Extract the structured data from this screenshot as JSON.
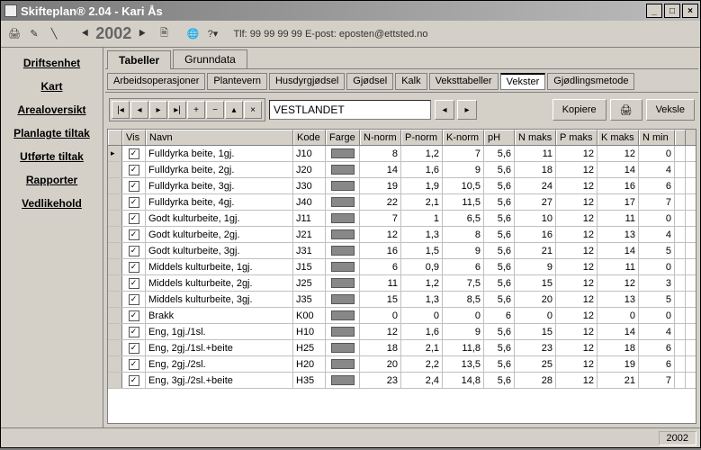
{
  "window": {
    "title": "Skifteplan® 2.04 - Kari Ås"
  },
  "toolbar": {
    "year": "2002",
    "info": "Tlf: 99 99 99 99  E-post: eposten@ettsted.no"
  },
  "sidebar": {
    "items": [
      {
        "label": "Driftsenhet"
      },
      {
        "label": "Kart"
      },
      {
        "label": "Arealoversikt"
      },
      {
        "label": "Planlagte tiltak"
      },
      {
        "label": "Utførte tiltak"
      },
      {
        "label": "Rapporter"
      },
      {
        "label": "Vedlikehold"
      }
    ]
  },
  "tabs": [
    {
      "label": "Tabeller",
      "active": true
    },
    {
      "label": "Grunndata",
      "active": false
    }
  ],
  "subtabs": [
    {
      "label": "Arbeidsoperasjoner"
    },
    {
      "label": "Plantevern"
    },
    {
      "label": "Husdyrgjødsel"
    },
    {
      "label": "Gjødsel"
    },
    {
      "label": "Kalk"
    },
    {
      "label": "Veksttabeller"
    },
    {
      "label": "Vekster",
      "active": true
    },
    {
      "label": "Gjødlingsmetode"
    }
  ],
  "combo": {
    "value": "VESTLANDET"
  },
  "buttons": {
    "kopiere": "Kopiere",
    "veksle": "Veksle"
  },
  "grid": {
    "headers": {
      "vis": "Vis",
      "navn": "Navn",
      "kode": "Kode",
      "farge": "Farge",
      "nnorm": "N-norm",
      "pnorm": "P-norm",
      "knorm": "K-norm",
      "ph": "pH",
      "nmaks": "N maks",
      "pmaks": "P maks",
      "kmaks": "K maks",
      "nmin": "N min"
    },
    "rows": [
      {
        "current": true,
        "vis": true,
        "navn": "Fulldyrka beite, 1gj.",
        "kode": "J10",
        "nnorm": "8",
        "pnorm": "1,2",
        "knorm": "7",
        "ph": "5,6",
        "nmaks": "11",
        "pmaks": "12",
        "kmaks": "12",
        "nmin": "0"
      },
      {
        "vis": true,
        "navn": "Fulldyrka beite, 2gj.",
        "kode": "J20",
        "nnorm": "14",
        "pnorm": "1,6",
        "knorm": "9",
        "ph": "5,6",
        "nmaks": "18",
        "pmaks": "12",
        "kmaks": "14",
        "nmin": "4"
      },
      {
        "vis": true,
        "navn": "Fulldyrka beite, 3gj.",
        "kode": "J30",
        "nnorm": "19",
        "pnorm": "1,9",
        "knorm": "10,5",
        "ph": "5,6",
        "nmaks": "24",
        "pmaks": "12",
        "kmaks": "16",
        "nmin": "6"
      },
      {
        "vis": true,
        "navn": "Fulldyrka beite, 4gj.",
        "kode": "J40",
        "nnorm": "22",
        "pnorm": "2,1",
        "knorm": "11,5",
        "ph": "5,6",
        "nmaks": "27",
        "pmaks": "12",
        "kmaks": "17",
        "nmin": "7"
      },
      {
        "vis": true,
        "navn": "Godt kulturbeite, 1gj.",
        "kode": "J11",
        "nnorm": "7",
        "pnorm": "1",
        "knorm": "6,5",
        "ph": "5,6",
        "nmaks": "10",
        "pmaks": "12",
        "kmaks": "11",
        "nmin": "0"
      },
      {
        "vis": true,
        "navn": "Godt kulturbeite, 2gj.",
        "kode": "J21",
        "nnorm": "12",
        "pnorm": "1,3",
        "knorm": "8",
        "ph": "5,6",
        "nmaks": "16",
        "pmaks": "12",
        "kmaks": "13",
        "nmin": "4"
      },
      {
        "vis": true,
        "navn": "Godt kulturbeite, 3gj.",
        "kode": "J31",
        "nnorm": "16",
        "pnorm": "1,5",
        "knorm": "9",
        "ph": "5,6",
        "nmaks": "21",
        "pmaks": "12",
        "kmaks": "14",
        "nmin": "5"
      },
      {
        "vis": true,
        "navn": "Middels kulturbeite, 1gj.",
        "kode": "J15",
        "nnorm": "6",
        "pnorm": "0,9",
        "knorm": "6",
        "ph": "5,6",
        "nmaks": "9",
        "pmaks": "12",
        "kmaks": "11",
        "nmin": "0"
      },
      {
        "vis": true,
        "navn": "Middels kulturbeite, 2gj.",
        "kode": "J25",
        "nnorm": "11",
        "pnorm": "1,2",
        "knorm": "7,5",
        "ph": "5,6",
        "nmaks": "15",
        "pmaks": "12",
        "kmaks": "12",
        "nmin": "3"
      },
      {
        "vis": true,
        "navn": "Middels kulturbeite, 3gj.",
        "kode": "J35",
        "nnorm": "15",
        "pnorm": "1,3",
        "knorm": "8,5",
        "ph": "5,6",
        "nmaks": "20",
        "pmaks": "12",
        "kmaks": "13",
        "nmin": "5"
      },
      {
        "vis": true,
        "navn": "Brakk",
        "kode": "K00",
        "nnorm": "0",
        "pnorm": "0",
        "knorm": "0",
        "ph": "6",
        "nmaks": "0",
        "pmaks": "12",
        "kmaks": "0",
        "nmin": "0"
      },
      {
        "vis": true,
        "navn": "Eng, 1gj./1sl.",
        "kode": "H10",
        "nnorm": "12",
        "pnorm": "1,6",
        "knorm": "9",
        "ph": "5,6",
        "nmaks": "15",
        "pmaks": "12",
        "kmaks": "14",
        "nmin": "4"
      },
      {
        "vis": true,
        "navn": "Eng, 2gj./1sl.+beite",
        "kode": "H25",
        "nnorm": "18",
        "pnorm": "2,1",
        "knorm": "11,8",
        "ph": "5,6",
        "nmaks": "23",
        "pmaks": "12",
        "kmaks": "18",
        "nmin": "6"
      },
      {
        "vis": true,
        "navn": "Eng, 2gj./2sl.",
        "kode": "H20",
        "nnorm": "20",
        "pnorm": "2,2",
        "knorm": "13,5",
        "ph": "5,6",
        "nmaks": "25",
        "pmaks": "12",
        "kmaks": "19",
        "nmin": "6"
      },
      {
        "vis": true,
        "navn": "Eng, 3gj./2sl.+beite",
        "kode": "H35",
        "nnorm": "23",
        "pnorm": "2,4",
        "knorm": "14,8",
        "ph": "5,6",
        "nmaks": "28",
        "pmaks": "12",
        "kmaks": "21",
        "nmin": "7"
      }
    ]
  },
  "status": {
    "year": "2002"
  }
}
